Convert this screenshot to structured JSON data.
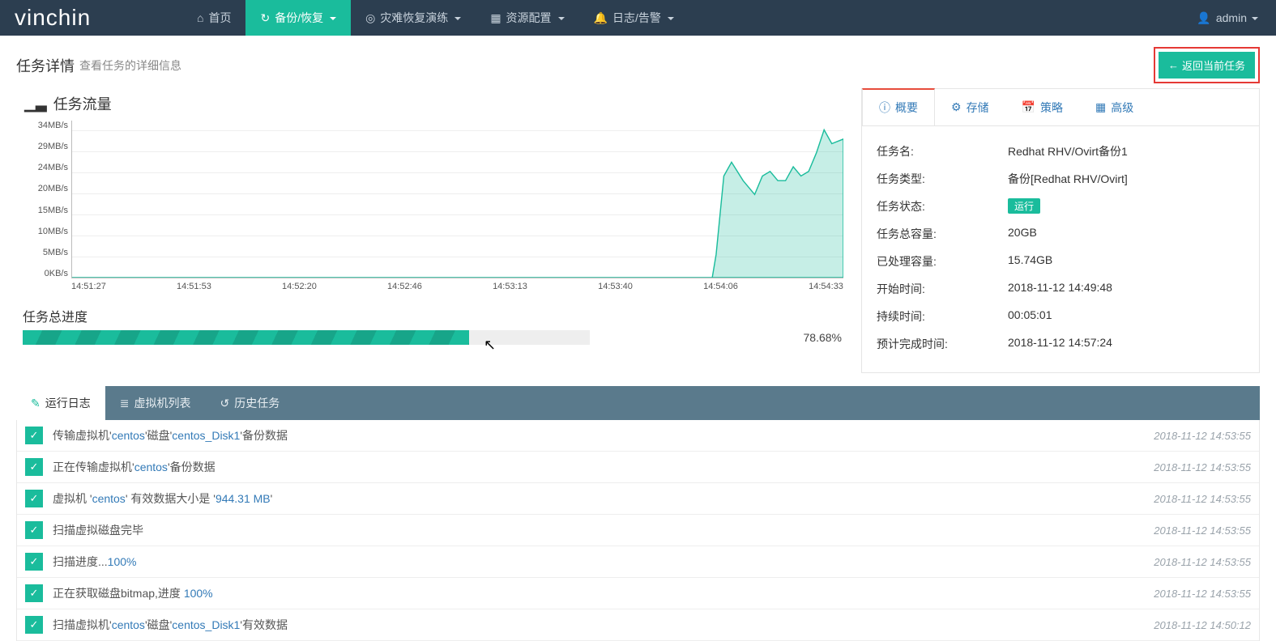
{
  "brand": "vinchin",
  "nav": {
    "home": "首页",
    "backup": "备份/恢复",
    "dr": "灾难恢复演练",
    "resource": "资源配置",
    "log": "日志/告警",
    "user": "admin"
  },
  "page": {
    "title": "任务详情",
    "subtitle": "查看任务的详细信息",
    "back_btn": "返回当前任务"
  },
  "chart": {
    "title": "任务流量"
  },
  "chart_data": {
    "type": "area",
    "title": "任务流量",
    "xlabel": "",
    "ylabel": "",
    "y_ticks": [
      "34MB/s",
      "29MB/s",
      "24MB/s",
      "20MB/s",
      "15MB/s",
      "10MB/s",
      "5MB/s",
      "0KB/s"
    ],
    "x_ticks": [
      "14:51:27",
      "14:51:53",
      "14:52:20",
      "14:52:46",
      "14:53:13",
      "14:53:40",
      "14:54:06",
      "14:54:33"
    ],
    "ylim": [
      0,
      34
    ],
    "x": [
      0,
      0.83,
      0.835,
      0.845,
      0.855,
      0.87,
      0.885,
      0.895,
      0.905,
      0.915,
      0.925,
      0.935,
      0.945,
      0.955,
      0.965,
      0.975,
      0.985,
      1.0
    ],
    "values": [
      0,
      0,
      5,
      22,
      25,
      21,
      18,
      22,
      23,
      21,
      21,
      24,
      22,
      23,
      27,
      32,
      29,
      30
    ]
  },
  "progress": {
    "title": "任务总进度",
    "percent": 78.68,
    "percent_label": "78.68%"
  },
  "summary_tabs": {
    "overview": "概要",
    "storage": "存储",
    "policy": "策略",
    "advanced": "高级"
  },
  "summary": {
    "labels": {
      "name": "任务名:",
      "type": "任务类型:",
      "state": "任务状态:",
      "total": "任务总容量:",
      "done": "已处理容量:",
      "start": "开始时间:",
      "dur": "持续时间:",
      "eta": "预计完成时间:"
    },
    "values": {
      "name": "Redhat RHV/Ovirt备份1",
      "type": "备份[Redhat RHV/Ovirt]",
      "state": "运行",
      "total": "20GB",
      "done": "15.74GB",
      "start": "2018-11-12 14:49:48",
      "dur": "00:05:01",
      "eta": "2018-11-12 14:57:24"
    }
  },
  "lower_tabs": {
    "runlog": "运行日志",
    "vmlist": "虚拟机列表",
    "history": "历史任务"
  },
  "logs": [
    {
      "html": "传输虚拟机'<span class='hl'>centos</span>'磁盘'<span class='hl'>centos_Disk1</span>'备份数据",
      "time": "2018-11-12 14:53:55"
    },
    {
      "html": "正在传输虚拟机'<span class='hl'>centos</span>'备份数据",
      "time": "2018-11-12 14:53:55"
    },
    {
      "html": "虚拟机 '<span class='hl'>centos</span>' 有效数据大小是 '<span class='hl'>944.31 MB</span>'",
      "time": "2018-11-12 14:53:55"
    },
    {
      "html": "扫描虚拟磁盘完毕",
      "time": "2018-11-12 14:53:55"
    },
    {
      "html": "扫描进度...<span class='hl'>100%</span>",
      "time": "2018-11-12 14:53:55"
    },
    {
      "html": "正在获取磁盘bitmap,进度 <span class='hl'>100%</span>",
      "time": "2018-11-12 14:53:55"
    },
    {
      "html": "扫描虚拟机'<span class='hl'>centos</span>'磁盘'<span class='hl'>centos_Disk1</span>'有效数据",
      "time": "2018-11-12 14:50:12"
    }
  ]
}
